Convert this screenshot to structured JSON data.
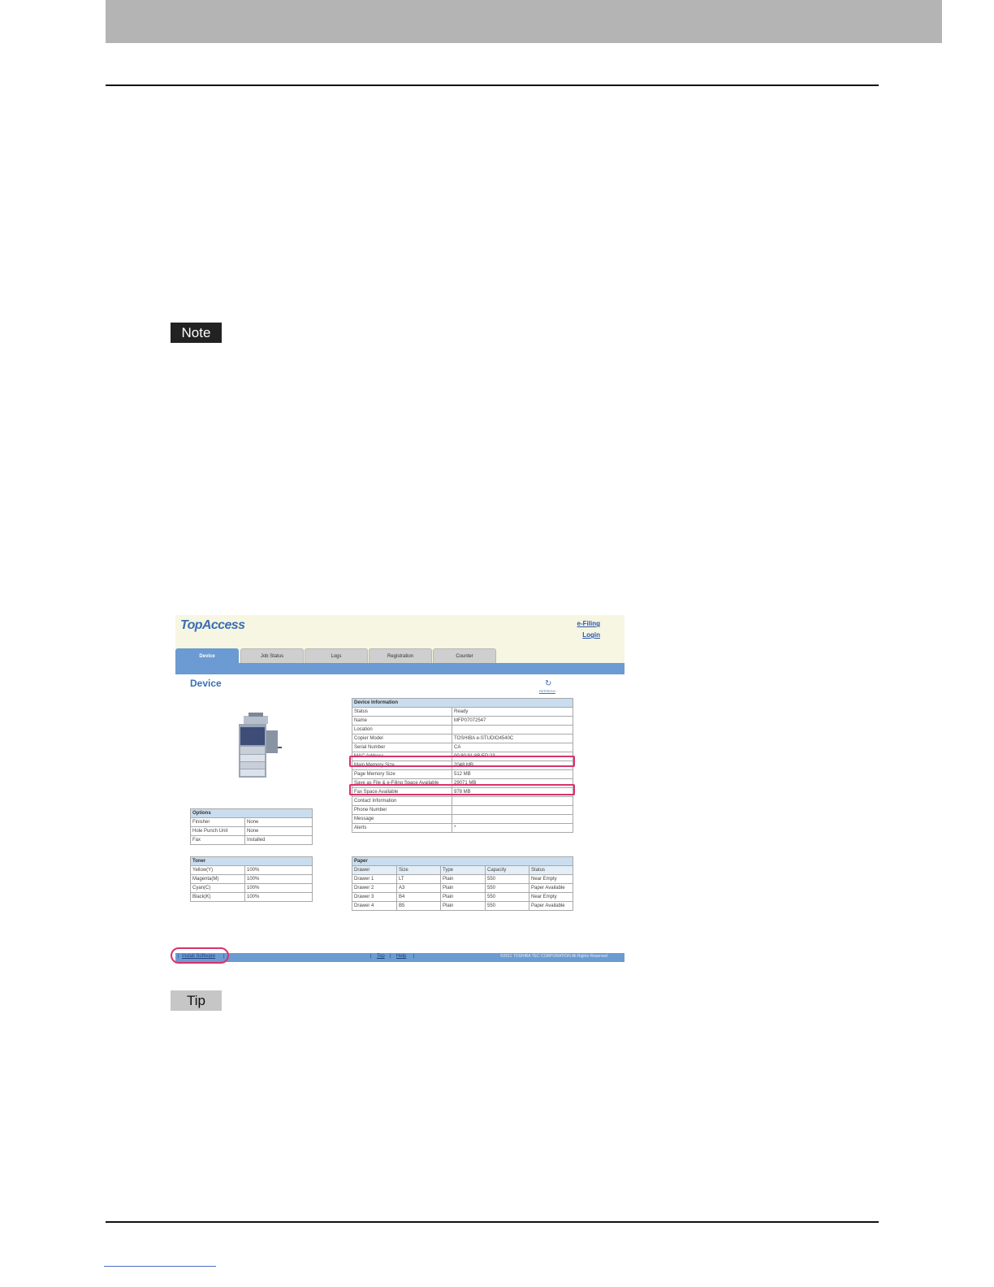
{
  "document": {
    "note_label": "Note",
    "tip_label": "Tip"
  },
  "topaccess": {
    "logo": "TopAccess",
    "links": {
      "efiling": "e-Filing",
      "login": "Login"
    },
    "tabs": [
      "Device",
      "Job Status",
      "Logs",
      "Registration",
      "Counter"
    ],
    "active_tab": "Device",
    "page_title": "Device",
    "refresh_label": "REFRESH",
    "device_info": {
      "header": "Device Information",
      "rows": [
        [
          "Status",
          "Ready"
        ],
        [
          "Name",
          "MFP07072547"
        ],
        [
          "Location",
          ""
        ],
        [
          "Copier Model",
          "TOSHIBA e-STUDIO4540C"
        ],
        [
          "Serial Number",
          "CA"
        ],
        [
          "MAC Address",
          "00:80:91:8B:ED:23"
        ],
        [
          "Main Memory Size",
          "2048 MB"
        ],
        [
          "Page Memory Size",
          "512 MB"
        ],
        [
          "Save as File & e-Filing Space Available",
          "29071 MB"
        ],
        [
          "Fax Space Available",
          "978 MB"
        ],
        [
          "Contact Information",
          ""
        ],
        [
          "Phone Number",
          ""
        ],
        [
          "Message",
          ""
        ],
        [
          "Alerts",
          "*"
        ]
      ]
    },
    "options": {
      "header": "Options",
      "rows": [
        [
          "Finisher",
          "None"
        ],
        [
          "Hole Punch Unit",
          "None"
        ],
        [
          "Fax",
          "Installed"
        ]
      ]
    },
    "toner": {
      "header": "Toner",
      "rows": [
        [
          "Yellow(Y)",
          "100%"
        ],
        [
          "Magenta(M)",
          "100%"
        ],
        [
          "Cyan(C)",
          "100%"
        ],
        [
          "Black(K)",
          "100%"
        ]
      ]
    },
    "paper": {
      "header": "Paper",
      "columns": [
        "Drawer",
        "Size",
        "Type",
        "Capacity",
        "Status"
      ],
      "rows": [
        [
          "Drawer 1",
          "LT",
          "Plain",
          "550",
          "Near Empty"
        ],
        [
          "Drawer 2",
          "A3",
          "Plain",
          "550",
          "Paper Available"
        ],
        [
          "Drawer 3",
          "B4",
          "Plain",
          "550",
          "Near Empty"
        ],
        [
          "Drawer 4",
          "B5",
          "Plain",
          "550",
          "Paper Available"
        ]
      ]
    },
    "footer": {
      "install_software": "Install Software",
      "top": "Top",
      "help": "Help",
      "copyright": "©2011 TOSHIBA TEC CORPORATION All Rights Reserved"
    }
  }
}
